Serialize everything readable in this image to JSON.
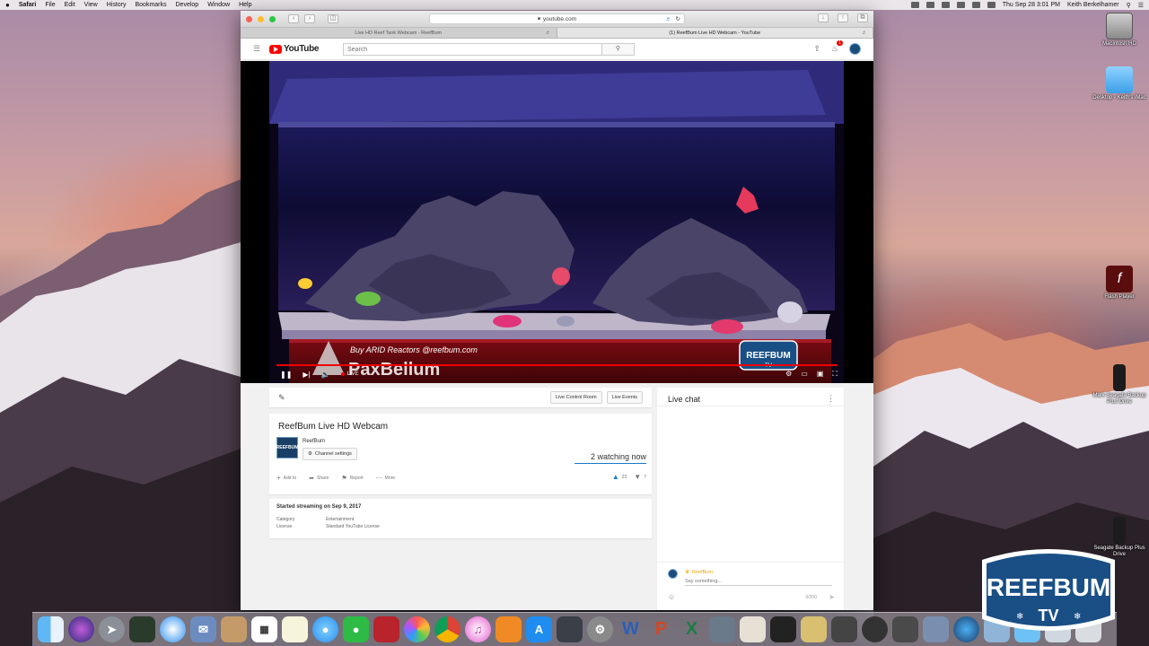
{
  "menubar": {
    "apple": "",
    "app": "Safari",
    "menus": [
      "File",
      "Edit",
      "View",
      "History",
      "Bookmarks",
      "Develop",
      "Window",
      "Help"
    ],
    "clock": "Thu Sep 28  3:01 PM",
    "user": "Keith Berkelhamer"
  },
  "desktop": {
    "icons": [
      {
        "label": "Macintosh HD"
      },
      {
        "label": "Desktop - Keith's iMac"
      },
      {
        "label": "Flash Player"
      },
      {
        "label": "Mark Seagate Backup Plus Drive"
      },
      {
        "label": "Seagate Backup Plus Drive"
      }
    ]
  },
  "browser": {
    "url": "youtube.com",
    "tabs": [
      {
        "title": "Live HD Reef Tank Webcam - ReefBum"
      },
      {
        "title": "(1) ReefBum Live HD Webcam - YouTube"
      }
    ]
  },
  "youtube": {
    "logo": "YouTube",
    "search_placeholder": "Search",
    "notifications": "1",
    "video": {
      "overlay_line1": "Buy ARID Reactors @reefbum.com",
      "overlay_line2": "PaxBellum",
      "watermark": "REEFBUM",
      "watermark_sub": "TV",
      "live_label": "LIVE"
    },
    "buttons": {
      "live_control_room": "Live Control Room",
      "live_events": "Live Events"
    },
    "title": "ReefBum Live HD Webcam",
    "channel": {
      "name": "ReefBum",
      "logo_text": "REEFBUM",
      "settings": "Channel settings"
    },
    "watching": "2 watching now",
    "actions": {
      "add_to": "Add to",
      "share": "Share",
      "report": "Report",
      "more": "More"
    },
    "likes": "23",
    "dislikes": "7",
    "description": {
      "started": "Started streaming on Sep 9, 2017",
      "category_label": "Category",
      "category_value": "Entertainment",
      "license_label": "License",
      "license_value": "Standard YouTube License"
    },
    "chat": {
      "title": "Live chat",
      "author": "ReefBum",
      "placeholder": "Say something...",
      "counter": "0/200"
    }
  },
  "badge": {
    "text": "REEFBUM",
    "sub": "TV"
  },
  "colors": {
    "yt_red": "#ff0000",
    "accent_blue": "#167ac6",
    "reefbum_blue": "#1a4f86"
  }
}
